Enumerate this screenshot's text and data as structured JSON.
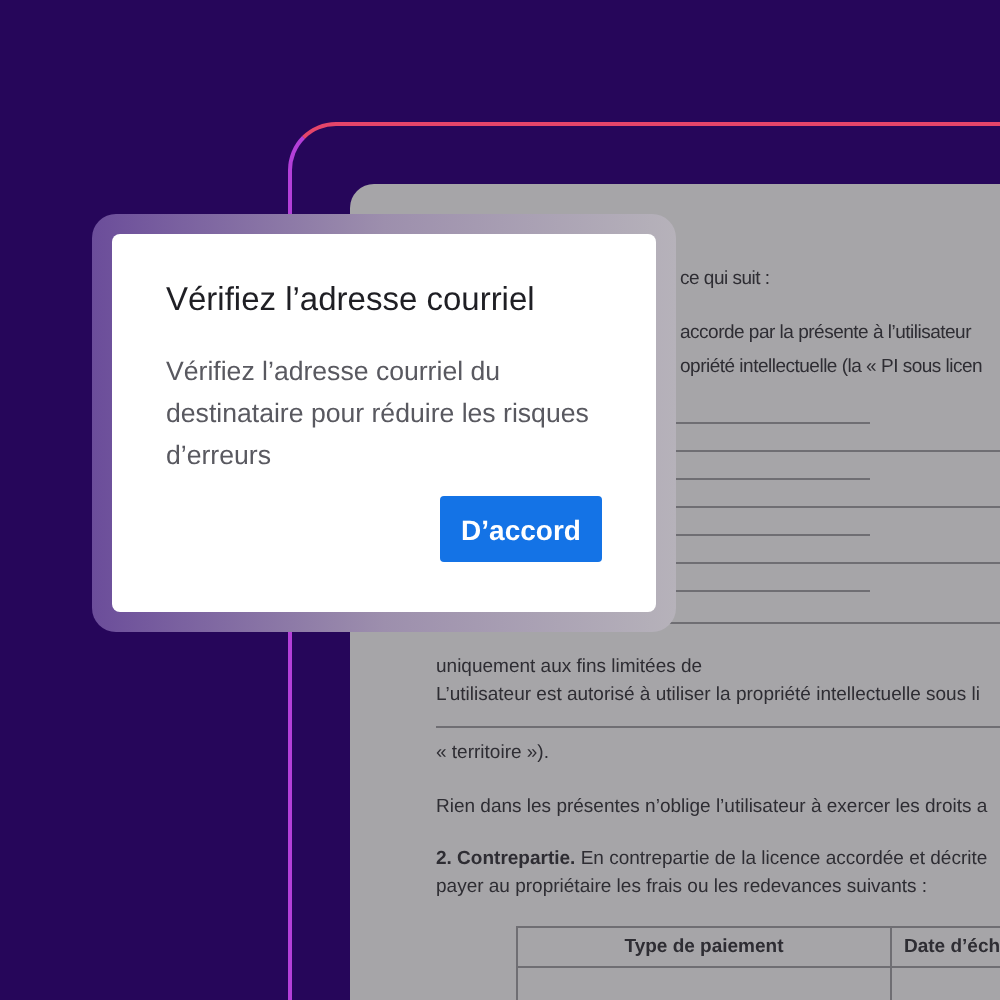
{
  "document": {
    "lines": [
      {
        "kind": "covered_text",
        "text": "ce qui suit :"
      },
      {
        "kind": "covered_text",
        "text": "accorde par la présente à l’utilisateur"
      },
      {
        "kind": "covered_text",
        "text": "opriété intellectuelle (la « PI sous licen"
      },
      {
        "kind": "short_blank"
      },
      {
        "kind": "long_blank"
      },
      {
        "kind": "short_blank"
      },
      {
        "kind": "long_blank"
      },
      {
        "kind": "short_blank"
      },
      {
        "kind": "long_blank"
      },
      {
        "kind": "short_blank"
      },
      {
        "kind": "wide_blank"
      },
      {
        "kind": "text",
        "text": "uniquement aux fins limitées de"
      },
      {
        "kind": "text",
        "text": "L’utilisateur est autorisé à utiliser la propriété intellectuelle sous li"
      },
      {
        "kind": "full_blank"
      },
      {
        "kind": "paragraph",
        "text": "« territoire »)."
      },
      {
        "kind": "paragraph",
        "text": "Rien dans les présentes n’oblige l’utilisateur à exercer les droits a"
      },
      {
        "kind": "paragraph",
        "text": "**2. Contrepartie.** En contrepartie de la licence accordée et décrite"
      },
      {
        "kind": "text",
        "text": "payer au propriétaire les frais ou les redevances suivants :"
      }
    ],
    "table": {
      "columns": [
        "Type de paiement",
        "Date d’éch"
      ]
    }
  },
  "dialog": {
    "title": "Vérifiez l’adresse courriel",
    "message": "Vérifiez l’adresse courriel du destinataire pour réduire les risques d’erreurs",
    "button": "D’accord"
  }
}
